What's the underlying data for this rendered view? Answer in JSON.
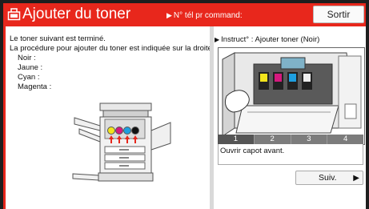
{
  "header": {
    "title": "Ajouter du toner",
    "notice_arrow": "▶",
    "notice": "N° tél pr command:",
    "exit_label": "Sortir"
  },
  "left": {
    "line1": "Le toner suivant est terminé.",
    "line2": "La procédure pour ajouter du toner est indiquée sur la droite.",
    "colors": [
      "Noir :",
      "Jaune :",
      "Cyan :",
      "Magenta :"
    ]
  },
  "right": {
    "title_arrow": "▶",
    "title": "Instruct° : Ajouter toner (Noir)",
    "steps": [
      "1",
      "2",
      "3",
      "4"
    ],
    "step_text": "Ouvrir capot avant.",
    "next_label": "Suiv."
  },
  "colors": {
    "header": "#e8271c",
    "yellow": "#f2e41c",
    "magenta": "#d6197e",
    "cyan": "#1e9fe0",
    "black": "#111111",
    "arrow_red": "#e8271c"
  },
  "icons": [
    "toner-icon",
    "printer-illustration",
    "next-arrow-icon"
  ]
}
